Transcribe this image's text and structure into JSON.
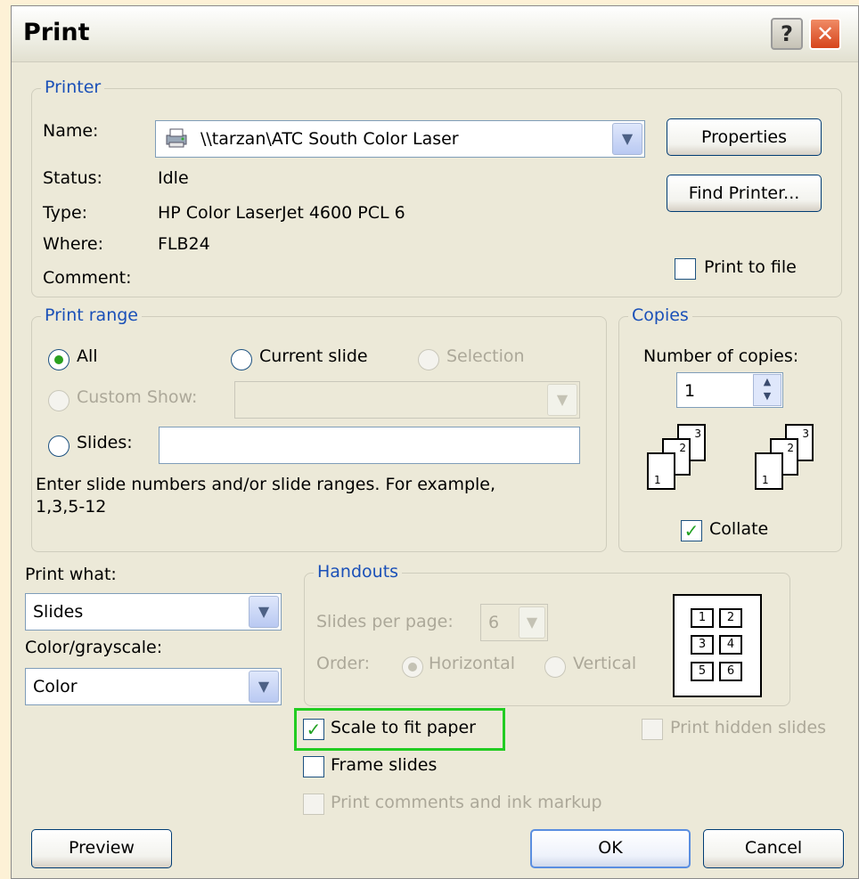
{
  "window": {
    "title": "Print"
  },
  "printer": {
    "legend": "Printer",
    "name_label": "Name:",
    "name_value": "\\\\tarzan\\ATC South Color Laser",
    "status_label": "Status:",
    "status_value": "Idle",
    "type_label": "Type:",
    "type_value": "HP Color LaserJet 4600 PCL 6",
    "where_label": "Where:",
    "where_value": "FLB24",
    "comment_label": "Comment:",
    "properties_label": "Properties",
    "find_printer_label": "Find Printer...",
    "print_to_file_label": "Print to file",
    "print_to_file_checked": false
  },
  "print_range": {
    "legend": "Print range",
    "all_label": "All",
    "current_slide_label": "Current slide",
    "selection_label": "Selection",
    "custom_show_label": "Custom Show:",
    "slides_label": "Slides:",
    "slides_value": "",
    "hint": "Enter slide numbers and/or slide ranges. For example,",
    "hint_example": "1,3,5-12",
    "selected": "All"
  },
  "copies": {
    "legend": "Copies",
    "number_label": "Number of copies:",
    "number_value": "1",
    "collate_label": "Collate",
    "collate_checked": true,
    "page_numbers": [
      "1",
      "2",
      "3"
    ]
  },
  "print_what": {
    "label": "Print what:",
    "value": "Slides"
  },
  "color": {
    "label": "Color/grayscale:",
    "value": "Color"
  },
  "handouts": {
    "legend": "Handouts",
    "slides_per_page_label": "Slides per page:",
    "slides_per_page_value": "6",
    "order_label": "Order:",
    "horizontal_label": "Horizontal",
    "vertical_label": "Vertical",
    "preview_numbers": [
      "1",
      "2",
      "3",
      "4",
      "5",
      "6"
    ]
  },
  "options": {
    "scale_to_fit_label": "Scale to fit paper",
    "scale_to_fit_checked": true,
    "frame_slides_label": "Frame slides",
    "frame_slides_checked": false,
    "print_comments_label": "Print comments and ink markup",
    "print_hidden_label": "Print hidden slides"
  },
  "buttons": {
    "preview": "Preview",
    "ok": "OK",
    "cancel": "Cancel"
  },
  "colors": {
    "legend_blue": "#1a50b8",
    "check_green": "#21a121",
    "highlight": "#22cc22"
  }
}
